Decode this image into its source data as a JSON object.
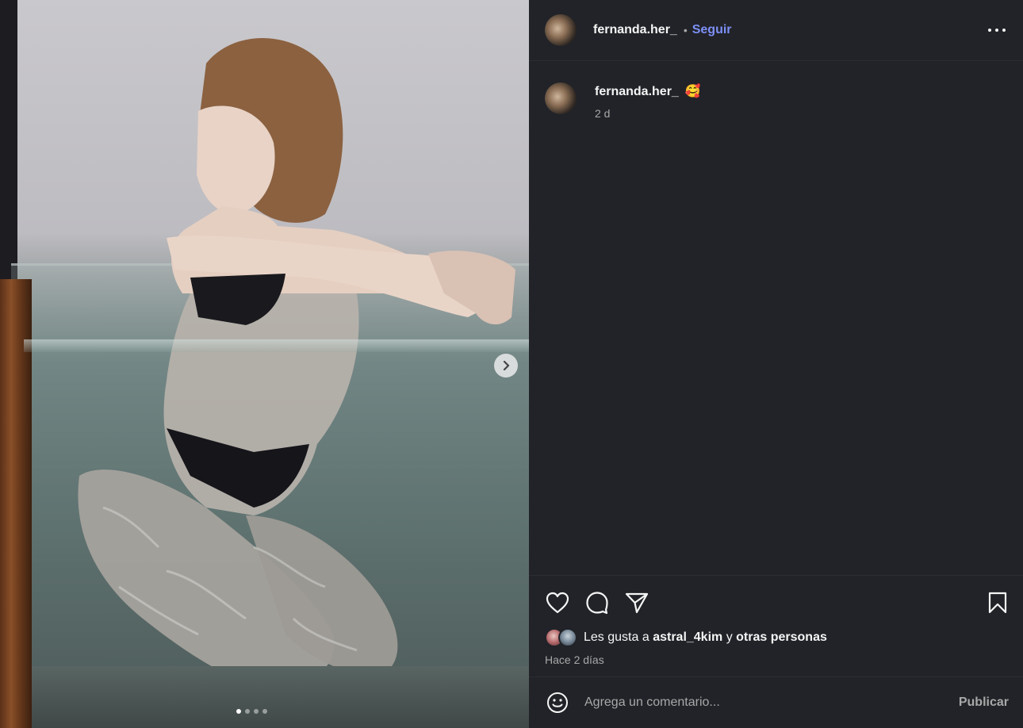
{
  "post": {
    "image_alt": "",
    "carousel": {
      "total": 4,
      "current": 1
    }
  },
  "header": {
    "username": "fernanda.her_",
    "separator": "•",
    "follow_label": "Seguir"
  },
  "caption": {
    "username": "fernanda.her_",
    "emoji": "🥰",
    "time": "2 d"
  },
  "actions": {
    "likes_prefix": "Les gusta a",
    "likes_user": "astral_4kim",
    "likes_conj": "y",
    "likes_others": "otras personas",
    "date": "Hace 2 días"
  },
  "comment": {
    "placeholder": "Agrega un comentario...",
    "publish_label": "Publicar"
  },
  "colors": {
    "background": "#212328",
    "accent": "#7d8ff5",
    "muted_text": "#a8a8a8"
  },
  "icons": [
    "next-icon",
    "more-icon",
    "heart-icon",
    "comment-icon",
    "share-icon",
    "bookmark-icon",
    "emoji-icon"
  ]
}
